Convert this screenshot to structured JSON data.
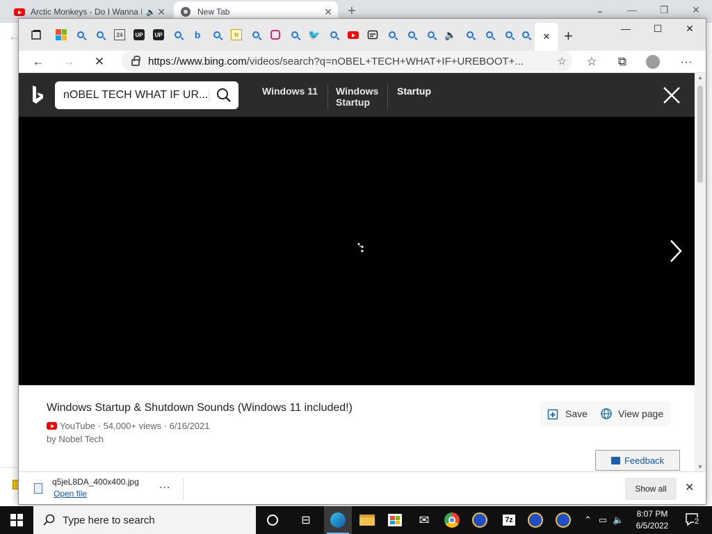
{
  "background_browser": {
    "tabs": [
      {
        "title": "Arctic Monkeys - Do I Wanna Know?",
        "favicon": "youtube-icon"
      },
      {
        "title": "New Tab",
        "favicon": "chrome-icon"
      }
    ]
  },
  "edge": {
    "address": {
      "url_host": "https://www.bing.com",
      "url_rest": "/videos/search?q=nOBEL+TECH+WHAT+IF+UREBOOT+..."
    }
  },
  "bing": {
    "search_value": "nOBEL TECH WHAT IF UR...",
    "tabs": [
      {
        "label": "Windows 11",
        "selected": false
      },
      {
        "label": "Windows Startup",
        "selected": false
      },
      {
        "label": "Startup",
        "selected": true
      }
    ],
    "video": {
      "title": "Windows Startup & Shutdown Sounds (Windows 11 included!)",
      "meta": "YouTube · 54,000+ views · 6/16/2021",
      "author": "by Nobel Tech",
      "save_label": "Save",
      "view_page_label": "View page"
    },
    "feedback_label": "Feedback"
  },
  "download": {
    "filename": "q5jeL8DA_400x400.jpg",
    "open_label": "Open file",
    "more_label": "...",
    "show_all_label": "Show all"
  },
  "taskbar": {
    "search_placeholder": "Type here to search",
    "time": "8:07 PM",
    "date": "6/5/2022",
    "notification_count": "2"
  },
  "colors": {
    "bing_header": "#2b2b2b",
    "player": "#000000",
    "taskbar": "#101010",
    "link": "#0b57d0"
  }
}
